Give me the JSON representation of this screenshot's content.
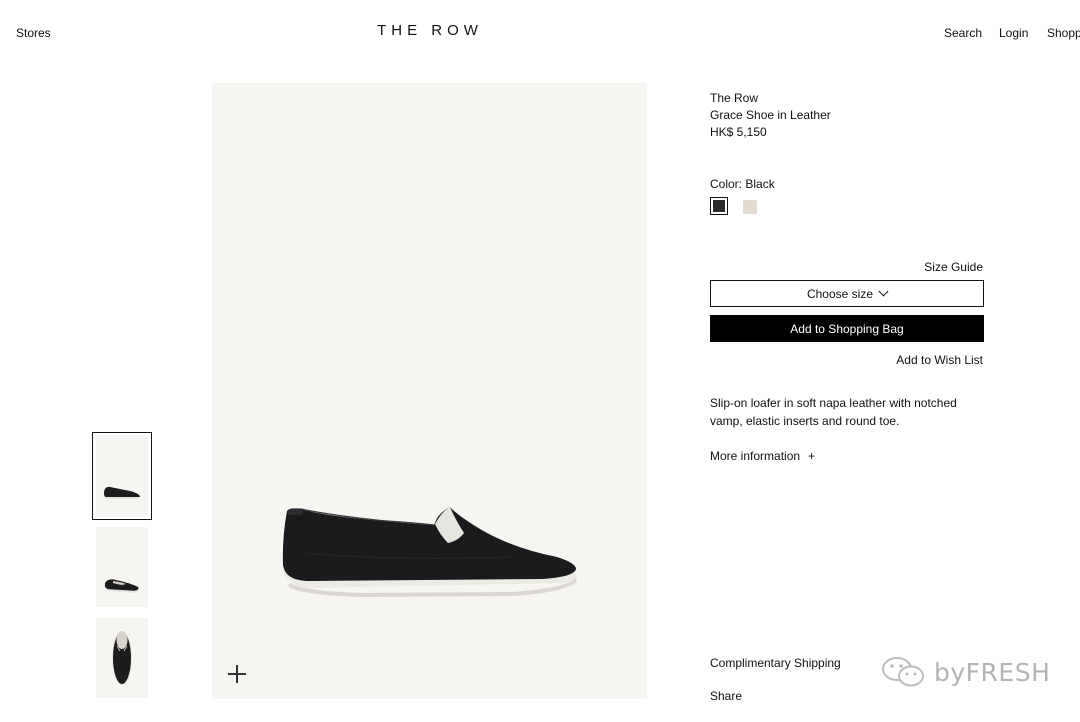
{
  "header": {
    "stores_label": "Stores",
    "brand": "THE ROW",
    "search_label": "Search",
    "login_label": "Login",
    "shopping_label": "Shopp"
  },
  "product": {
    "brand": "The Row",
    "name": "Grace Shoe in Leather",
    "price": "HK$ 5,150",
    "color_label": "Color: Black",
    "swatches": [
      {
        "name": "Black",
        "color": "#2b2b2b",
        "selected": true
      },
      {
        "name": "Sand",
        "color": "#e3ddd1",
        "selected": false
      }
    ],
    "size_guide_label": "Size Guide",
    "size_select_label": "Choose size",
    "add_to_bag_label": "Add to Shopping Bag",
    "wish_list_label": "Add to Wish List",
    "description": "Slip-on loafer in soft napa leather with notched vamp, elastic inserts and round toe.",
    "more_info_label": "More information",
    "more_info_icon": "+",
    "shipping_label": "Complimentary Shipping",
    "share_label": "Share"
  },
  "gallery": {
    "thumbnail_count": 3,
    "active_index": 0,
    "zoom_icon": "plus-icon"
  },
  "colors": {
    "background": "#ffffff",
    "image_bg": "#f6f5f2",
    "button_bg": "#000000",
    "text": "#111111"
  },
  "watermark": {
    "text": "byFRESH"
  }
}
